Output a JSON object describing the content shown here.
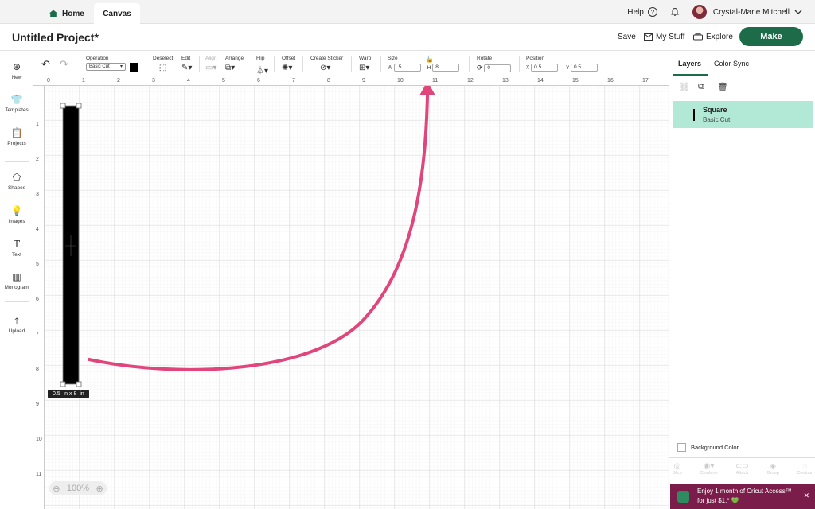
{
  "tabs": {
    "home": "Home",
    "canvas": "Canvas"
  },
  "user": {
    "help": "Help",
    "name": "Crystal-Marie Mitchell"
  },
  "header": {
    "title": "Untitled Project*",
    "save": "Save",
    "mystuff": "My Stuff",
    "explore": "Explore",
    "make": "Make"
  },
  "sidebar": {
    "items": [
      "New",
      "Templates",
      "Projects",
      "Shapes",
      "Images",
      "Text",
      "Monogram",
      "Upload"
    ]
  },
  "toolbar": {
    "operation": "Operation",
    "operation_value": "Basic Cut",
    "deselect": "Deselect",
    "edit": "Edit",
    "align": "Align",
    "arrange": "Arrange",
    "flip": "Flip",
    "offset": "Offset",
    "sticker": "Create Sticker",
    "warp": "Warp",
    "size": "Size",
    "w_label": "W",
    "w_value": ".5",
    "h_label": "H",
    "h_value": "8",
    "rotate": "Rotate",
    "rotate_value": "0",
    "position": "Position",
    "x_label": "X",
    "x_value": "0.5",
    "y_label": "Y",
    "y_value": "0.5"
  },
  "ruler": {
    "top": [
      "0",
      "1",
      "2",
      "3",
      "4",
      "5",
      "6",
      "7",
      "8",
      "9",
      "10",
      "11",
      "12",
      "13",
      "14",
      "15",
      "16",
      "17"
    ],
    "left": [
      "1",
      "2",
      "3",
      "4",
      "5",
      "6",
      "7",
      "8",
      "9",
      "10",
      "11"
    ]
  },
  "canvas": {
    "size_label": "0.5  in x 8  in",
    "zoom": "100%",
    "shape_color": "#000000",
    "arrow_color": "#e0457b"
  },
  "panel": {
    "layers": "Layers",
    "colorsync": "Color Sync",
    "layer_name": "Square",
    "layer_sub": "Basic Cut",
    "bg_color": "Background Color",
    "bottom_tools": [
      "Slice",
      "Combine",
      "Attach",
      "Group",
      "Contour"
    ]
  },
  "promo": {
    "line1": "Enjoy 1 month of Cricut Access™",
    "line2": "for just $1.* 💚"
  }
}
